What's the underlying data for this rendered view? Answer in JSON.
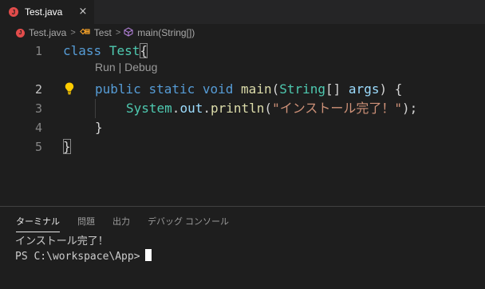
{
  "tab": {
    "file_icon_letter": "J",
    "filename": "Test.java",
    "close_glyph": "×"
  },
  "breadcrumb": {
    "file": "Test.java",
    "class_name": "Test",
    "method": "main(String[])",
    "separator": ">"
  },
  "editor": {
    "line_numbers": [
      "1",
      "2",
      "3",
      "4",
      "5"
    ],
    "active_line": "2",
    "codelens": "Run | Debug",
    "lines": {
      "l1_kw": "class",
      "l1_name": "Test",
      "l1_brace": "{",
      "l2_public": "public",
      "l2_static": "static",
      "l2_void": "void",
      "l2_main": "main",
      "l2_open": "(",
      "l2_type": "String",
      "l2_arr": "[]",
      "l2_args": "args",
      "l2_close": ")",
      "l2_brace": "{",
      "l3_system": "System",
      "l3_dot1": ".",
      "l3_out": "out",
      "l3_dot2": ".",
      "l3_println": "println",
      "l3_open": "(",
      "l3_string": "\"インストール完了！\"",
      "l3_end": ");",
      "l4_brace": "}",
      "l5_brace": "}"
    },
    "lightbulb_icon": "lightbulb-icon"
  },
  "panel": {
    "tabs": [
      "ターミナル",
      "問題",
      "出力",
      "デバッグ コンソール"
    ],
    "active_tab": "ターミナル",
    "terminal_output": "インストール完了！",
    "prompt": "PS C:\\workspace\\App>"
  },
  "colors": {
    "background": "#1e1e1e",
    "keyword": "#569cd6",
    "type": "#4ec9b0",
    "function": "#dcdcaa",
    "variable": "#9cdcfe",
    "string": "#ce9178",
    "java_badge": "#e24c4b"
  }
}
